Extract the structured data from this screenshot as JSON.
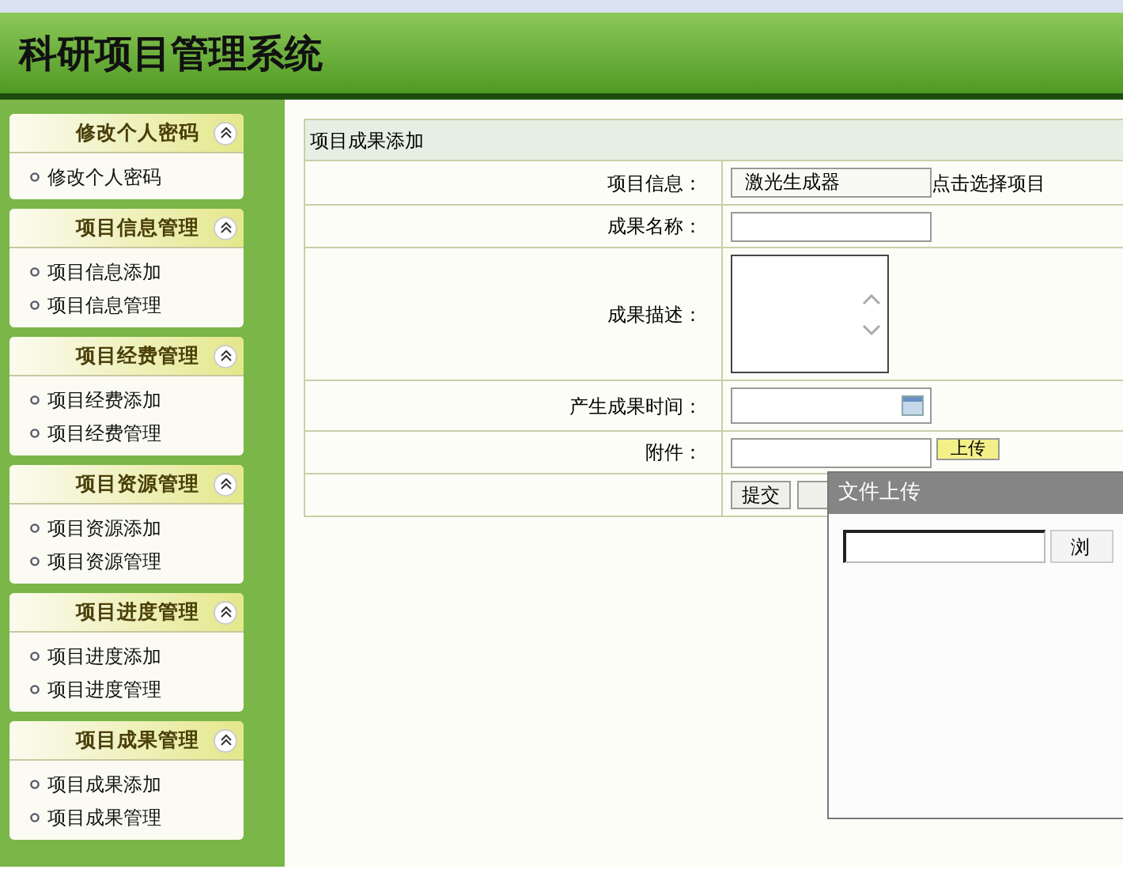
{
  "header": {
    "title": "科研项目管理系统"
  },
  "sidebar": [
    {
      "title": "修改个人密码",
      "expanded": true,
      "items": [
        "修改个人密码"
      ]
    },
    {
      "title": "项目信息管理",
      "expanded": true,
      "items": [
        "项目信息添加",
        "项目信息管理"
      ]
    },
    {
      "title": "项目经费管理",
      "expanded": true,
      "items": [
        "项目经费添加",
        "项目经费管理"
      ]
    },
    {
      "title": "项目资源管理",
      "expanded": true,
      "items": [
        "项目资源添加",
        "项目资源管理"
      ]
    },
    {
      "title": "项目进度管理",
      "expanded": true,
      "items": [
        "项目进度添加",
        "项目进度管理"
      ]
    },
    {
      "title": "项目成果管理",
      "expanded": true,
      "items": [
        "项目成果添加",
        "项目成果管理"
      ]
    }
  ],
  "form": {
    "title": "项目成果添加",
    "rows": [
      {
        "kind": "select",
        "label": "项目信息：",
        "value": "激光生成器",
        "link": "点击选择项目"
      },
      {
        "kind": "text",
        "label": "成果名称："
      },
      {
        "kind": "textarea",
        "label": "成果描述："
      },
      {
        "kind": "date",
        "label": "产生成果时间："
      },
      {
        "kind": "file",
        "label": "附件：",
        "button": "上传"
      }
    ],
    "buttons": [
      "提交"
    ]
  },
  "dialog": {
    "title": "文件上传",
    "browse_button": "浏"
  }
}
